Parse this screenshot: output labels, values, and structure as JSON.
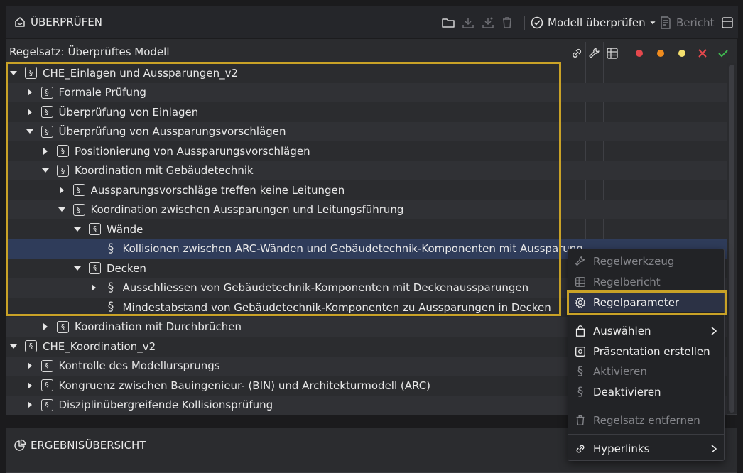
{
  "review_panel": {
    "title": "ÜBERPRÜFEN",
    "check_model_label": "Modell überprüfen",
    "report_label": "Bericht",
    "ruleset_label": "Regelsatz: Überprüftes Modell"
  },
  "status_colors": {
    "red": "#e5484d",
    "orange": "#f08c1e",
    "yellow": "#f5e06e",
    "cross": "#e5484d",
    "check": "#3fb950"
  },
  "tree": [
    {
      "label": "CHE_Einlagen und Aussparungen_v2",
      "level": 0,
      "toggle": "expanded"
    },
    {
      "label": "Formale Prüfung",
      "level": 1,
      "toggle": "collapsed"
    },
    {
      "label": "Überprüfung von Einlagen",
      "level": 1,
      "toggle": "collapsed"
    },
    {
      "label": "Überprüfung von Aussparungsvorschlägen",
      "level": 1,
      "toggle": "expanded"
    },
    {
      "label": "Positionierung von Aussparungsvorschlägen",
      "level": 2,
      "toggle": "collapsed"
    },
    {
      "label": "Koordination mit Gebäudetechnik",
      "level": 2,
      "toggle": "expanded"
    },
    {
      "label": "Aussparungsvorschläge treffen keine Leitungen",
      "level": 3,
      "toggle": "collapsed"
    },
    {
      "label": "Koordination zwischen Aussparungen und Leitungsführung",
      "level": 3,
      "toggle": "expanded"
    },
    {
      "label": "Wände",
      "level": 4,
      "toggle": "expanded"
    },
    {
      "label": "Kollisionen zwischen ARC-Wänden und Gebäudetechnik-Komponenten mit Aussparung",
      "level": 5,
      "toggle": "none"
    },
    {
      "label": "Decken",
      "level": 4,
      "toggle": "expanded"
    },
    {
      "label": "Ausschliessen von Gebäudetechnik-Komponenten mit Deckenaussparungen",
      "level": 5,
      "toggle": "collapsed"
    },
    {
      "label": "Mindestabstand von Gebäudetechnik-Komponenten zu Aussparungen in Decken",
      "level": 5,
      "toggle": "none"
    },
    {
      "label": "Koordination mit Durchbrüchen",
      "level": 2,
      "toggle": "collapsed"
    },
    {
      "label": "CHE_Koordination_v2",
      "level": 0,
      "toggle": "expanded"
    },
    {
      "label": "Kontrolle des Modellursprungs",
      "level": 1,
      "toggle": "collapsed"
    },
    {
      "label": "Kongruenz zwischen Bauingenieur- (BIN) und Architekturmodell (ARC)",
      "level": 1,
      "toggle": "collapsed"
    },
    {
      "label": "Disziplinübergreifende Kollisionsprüfung",
      "level": 1,
      "toggle": "collapsed"
    }
  ],
  "results_panel": {
    "title": "ERGEBNISÜBERSICHT"
  },
  "context_menu": {
    "items": [
      {
        "label": "Regelwerkzeug",
        "icon": "wrench-icon",
        "enabled": false
      },
      {
        "label": "Regelbericht",
        "icon": "table-icon",
        "enabled": false
      },
      {
        "label": "Regelparameter",
        "icon": "gear-icon",
        "enabled": true
      },
      {
        "label": "Auswählen",
        "icon": "bag-icon",
        "enabled": true
      },
      {
        "label": "Präsentation erstellen",
        "icon": "presentation-icon",
        "enabled": true
      },
      {
        "label": "Aktivieren",
        "icon": "paragraph-icon",
        "enabled": false
      },
      {
        "label": "Deaktivieren",
        "icon": "paragraph-icon",
        "enabled": true
      },
      {
        "label": "Regelsatz entfernen",
        "icon": "trash-icon",
        "enabled": false
      },
      {
        "label": "Hyperlinks",
        "icon": "link-icon",
        "enabled": true
      }
    ]
  }
}
